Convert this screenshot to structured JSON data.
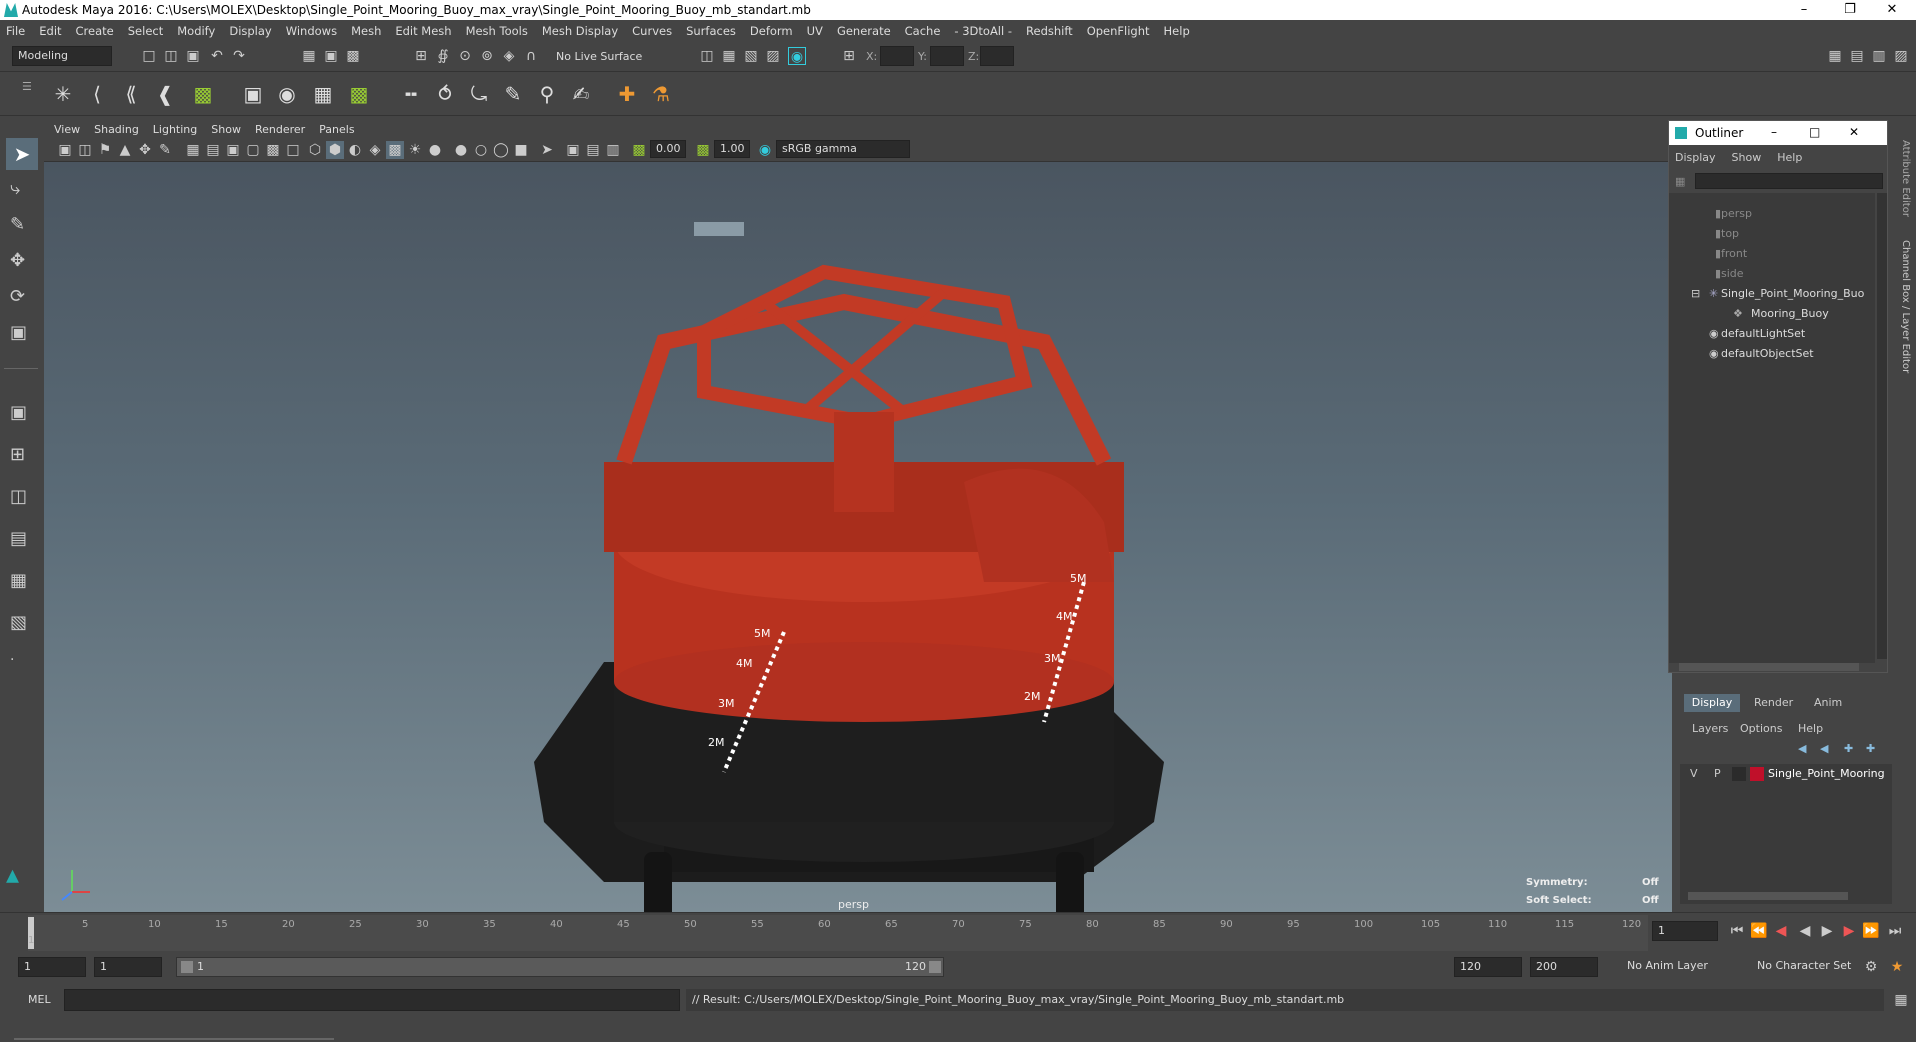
{
  "app": {
    "title": "Autodesk Maya 2016: C:\\Users\\MOLEX\\Desktop\\Single_Point_Mooring_Buoy_max_vray\\Single_Point_Mooring_Buoy_mb_standart.mb"
  },
  "menu": [
    "File",
    "Edit",
    "Create",
    "Select",
    "Modify",
    "Display",
    "Windows",
    "Mesh",
    "Edit Mesh",
    "Mesh Tools",
    "Mesh Display",
    "Curves",
    "Surfaces",
    "Deform",
    "UV",
    "Generate",
    "Cache",
    "- 3DtoAll -",
    "Redshift",
    "OpenFlight",
    "Help"
  ],
  "status": {
    "mode": "Modeling",
    "live_surface": "No Live Surface",
    "x_label": "X:",
    "y_label": "Y:",
    "z_label": "Z:"
  },
  "viewport": {
    "menu": [
      "View",
      "Shading",
      "Lighting",
      "Show",
      "Renderer",
      "Panels"
    ],
    "exposure": "0.00",
    "gamma": "1.00",
    "color_space": "sRGB gamma",
    "camera": "persp",
    "symmetry_label": "Symmetry:",
    "symmetry_value": "Off",
    "soft_select_label": "Soft Select:",
    "soft_select_value": "Off",
    "buoy_marks": [
      "5M",
      "4M",
      "3M",
      "2M",
      "5M",
      "4M",
      "3M",
      "2M"
    ]
  },
  "outliner": {
    "title": "Outliner",
    "menu": [
      "Display",
      "Show",
      "Help"
    ],
    "items": [
      {
        "label": "persp",
        "dim": true
      },
      {
        "label": "top",
        "dim": true
      },
      {
        "label": "front",
        "dim": true
      },
      {
        "label": "side",
        "dim": true
      },
      {
        "label": "Single_Point_Mooring_Buo",
        "dim": false
      },
      {
        "label": "Mooring_Buoy",
        "dim": false
      },
      {
        "label": "defaultLightSet",
        "dim": false
      },
      {
        "label": "defaultObjectSet",
        "dim": false
      }
    ]
  },
  "right_tabs": [
    "Attribute Editor",
    "Channel Box / Layer Editor"
  ],
  "layers": {
    "tabs": [
      "Display",
      "Render",
      "Anim"
    ],
    "menu": [
      "Layers",
      "Options",
      "Help"
    ],
    "row": {
      "v": "V",
      "p": "P",
      "name": "Single_Point_Mooring",
      "color": "#c0102a"
    }
  },
  "timeline": {
    "ticks": [
      "1",
      "5",
      "10",
      "15",
      "20",
      "25",
      "30",
      "35",
      "40",
      "45",
      "50",
      "55",
      "60",
      "65",
      "70",
      "75",
      "80",
      "85",
      "90",
      "95",
      "100",
      "105",
      "110",
      "115",
      "120"
    ],
    "current": "1"
  },
  "range": {
    "start": "1",
    "start2": "1",
    "slider_start": "1",
    "slider_end": "120",
    "end": "120",
    "end2": "200",
    "anim_layer": "No Anim Layer",
    "char_set": "No Character Set"
  },
  "cmd": {
    "label": "MEL",
    "result": "// Result: C:/Users/MOLEX/Desktop/Single_Point_Mooring_Buoy_max_vray/Single_Point_Mooring_Buoy_mb_standart.mb"
  },
  "colors": {
    "buoy_red": "#b8321f",
    "buoy_black": "#1c1c1c"
  }
}
